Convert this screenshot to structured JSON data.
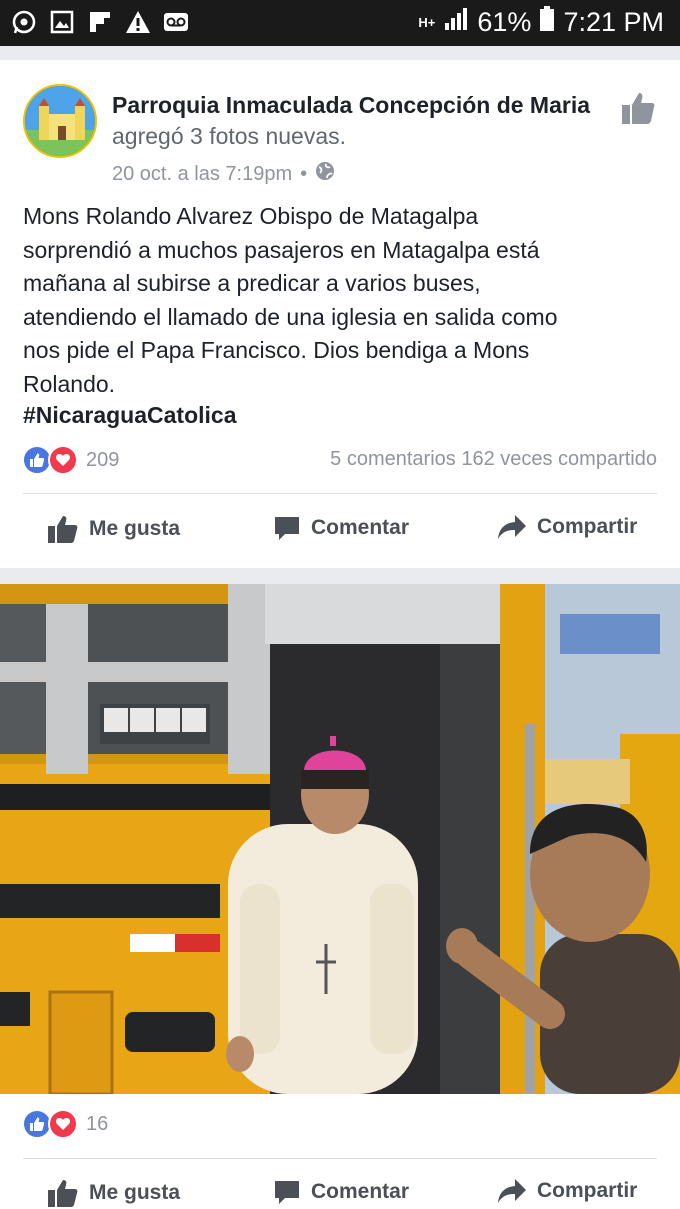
{
  "status_bar": {
    "network": "H+",
    "battery": "61%",
    "time": "7:21 PM",
    "icons": [
      "whatsapp-icon",
      "gallery-icon",
      "flipboard-icon",
      "warning-icon",
      "voicemail-icon"
    ]
  },
  "post": {
    "page_name": "Parroquia Inmaculada Concepción de Maria",
    "action": "agregó 3 fotos nuevas.",
    "timestamp": "20 oct. a las 7:19pm",
    "separator": "•",
    "text": "Mons Rolando Alvarez Obispo de Matagalpa\nsorprendió a muchos pasajeros en Matagalpa está\nmañana al subirse a predicar a varios buses,\natendiendo el llamado de una iglesia en salida como\nnos pide el Papa Francisco. Dios bendiga a Mons\nRolando.",
    "hashtag": "#NicaraguaCatolica",
    "reactions_count": "209",
    "comments": "5 comentarios",
    "shares": "162 veces compartido"
  },
  "actions": {
    "like": "Me gusta",
    "comment": "Comentar",
    "share": "Compartir"
  },
  "photo": {
    "reactions_count": "16"
  },
  "colors": {
    "like_blue": "#4a76e0",
    "love_red": "#f0394b",
    "bus_yellow": "#e8a515",
    "mitre_pink": "#e0449a"
  }
}
